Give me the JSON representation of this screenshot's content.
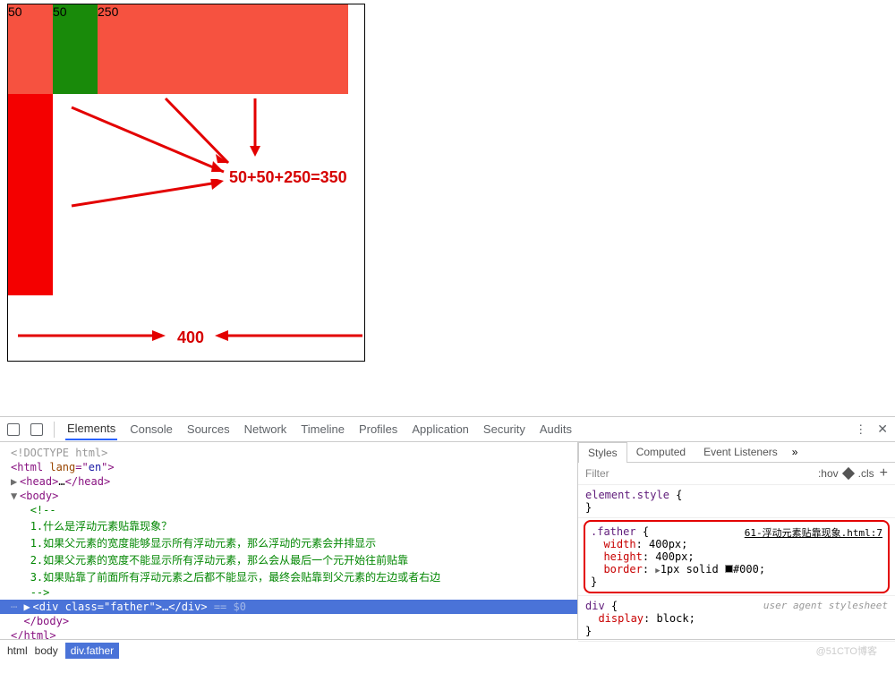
{
  "viewport": {
    "boxes": {
      "b1": "50",
      "b2": "50",
      "b3": "250"
    },
    "formula": "50+50+250=350",
    "width_label": "400"
  },
  "devtools": {
    "tabs": [
      "Elements",
      "Console",
      "Sources",
      "Network",
      "Timeline",
      "Profiles",
      "Application",
      "Security",
      "Audits"
    ],
    "active_tab": "Elements",
    "dom": {
      "doctype": "<!DOCTYPE html>",
      "html_open": "<html lang=\"en\">",
      "head": "<head>…</head>",
      "body_open": "<body>",
      "comment_start": "<!--",
      "q1": "1.什么是浮动元素贴靠现象？",
      "a1": "1.如果父元素的宽度能够显示所有浮动元素，那么浮动的元素会并排显示",
      "a2": "2.如果父元素的宽度不能显示所有浮动元素，那么会从最后一个元开始往前贴靠",
      "a3": "3.如果贴靠了前面所有浮动元素之后都不能显示，最终会贴靠到父元素的左边或者右边",
      "comment_end": "-->",
      "selected": "<div class=\"father\">…</div>",
      "eq": " == $0",
      "body_close": "</body>",
      "html_close": "</html>"
    },
    "styles": {
      "tabs": [
        "Styles",
        "Computed",
        "Event Listeners"
      ],
      "filter_placeholder": "Filter",
      "hov": ":hov",
      "cls": ".cls",
      "element_style": "element.style",
      "father": {
        "selector": ".father",
        "source": "61-浮动元素贴靠现象.html:7",
        "props": [
          {
            "name": "width",
            "value": "400px;"
          },
          {
            "name": "height",
            "value": "400px;"
          },
          {
            "name": "border",
            "value": "1px solid ",
            "color": "#000;"
          }
        ]
      },
      "ua": {
        "selector": "div",
        "note": "user agent stylesheet",
        "prop": "display",
        "val": "block;"
      }
    },
    "breadcrumb": [
      "html",
      "body",
      "div.father"
    ]
  },
  "watermark": "@51CTO博客"
}
